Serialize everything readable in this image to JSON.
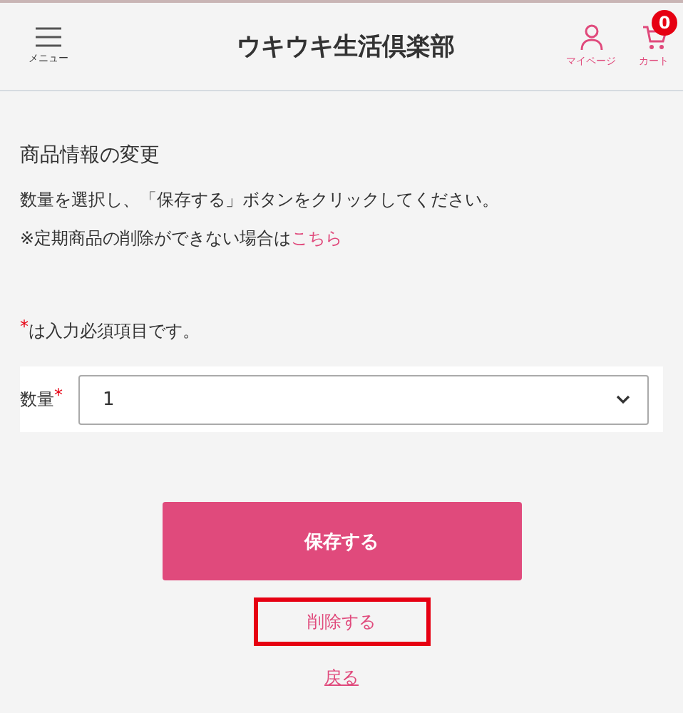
{
  "header": {
    "menu_label": "メニュー",
    "logo": "ウキウキ生活倶楽部",
    "mypage_label": "マイページ",
    "cart_label": "カート",
    "cart_count": "0"
  },
  "page": {
    "title": "商品情報の変更",
    "instruction": "数量を選択し、「保存する」ボタンをクリックしてください。",
    "notice": "※定期商品の削除ができない場合は",
    "notice_link": "こちら"
  },
  "required_note": {
    "mark": "*",
    "text": "は入力必須項目です。"
  },
  "form": {
    "label": "数量",
    "mark": "*",
    "value": "1"
  },
  "buttons": {
    "save": "保存する",
    "delete": {
      "label": "削除する",
      "highlighted": true
    },
    "back": "戻る"
  }
}
